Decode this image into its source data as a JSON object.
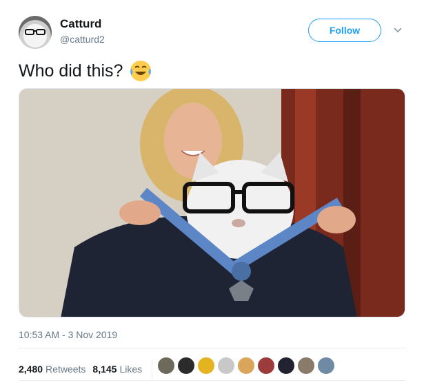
{
  "author": {
    "name": "Catturd",
    "handle": "@catturd2"
  },
  "follow_label": "Follow",
  "tweet": {
    "text": "Who did this?",
    "emoji": "face-with-tears-of-joy"
  },
  "timestamp": "10:53 AM - 3 Nov 2019",
  "stats": {
    "retweets_count": "2,480",
    "retweets_label": "Retweets",
    "likes_count": "8,145",
    "likes_label": "Likes"
  },
  "liker_avatars": [
    {
      "color": "#6d6a5c"
    },
    {
      "color": "#2b2b2b"
    },
    {
      "color": "#e3b320"
    },
    {
      "color": "#c8c8c8"
    },
    {
      "color": "#d9a55a"
    },
    {
      "color": "#9c3b3b"
    },
    {
      "color": "#222233"
    },
    {
      "color": "#8a7a6a"
    },
    {
      "color": "#6e8aa5"
    }
  ],
  "colors": {
    "accent": "#1da1f2",
    "secondary_text": "#657786"
  }
}
